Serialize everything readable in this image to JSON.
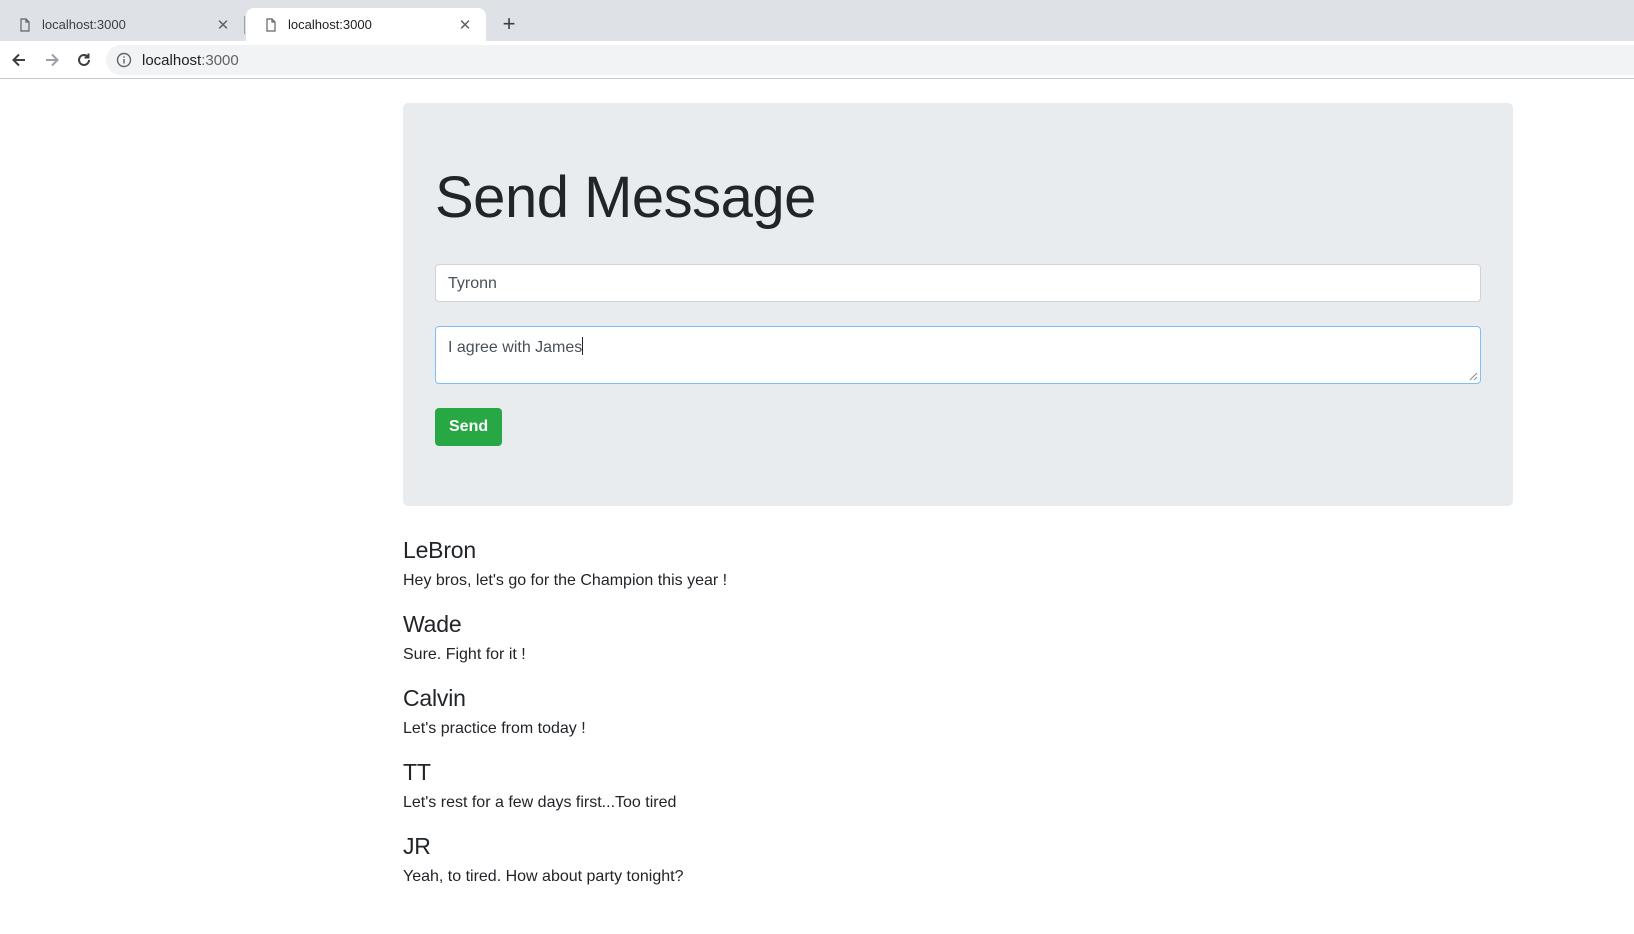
{
  "browser": {
    "tabs": [
      {
        "title": "localhost:3000",
        "active": false
      },
      {
        "title": "localhost:3000",
        "active": true
      }
    ],
    "address": {
      "host": "localhost",
      "port": ":3000"
    }
  },
  "form": {
    "title": "Send Message",
    "name_value": "Tyronn",
    "message_value": "I agree with James",
    "send_label": "Send"
  },
  "messages": [
    {
      "name": "LeBron",
      "text": "Hey bros, let's go for the Champion this year !"
    },
    {
      "name": "Wade",
      "text": "Sure. Fight for it !"
    },
    {
      "name": "Calvin",
      "text": "Let's practice from today !"
    },
    {
      "name": "TT",
      "text": "Let's rest for a few days first...Too tired"
    },
    {
      "name": "JR",
      "text": "Yeah, to tired. How about party tonight?"
    }
  ],
  "colors": {
    "accent_green": "#28a745",
    "jumbotron_bg": "#e9ecef",
    "focus_border": "#80bdff"
  },
  "icons": {
    "tab": "page-icon",
    "close": "close-icon",
    "new_tab": "plus-icon",
    "back": "back-arrow-icon",
    "forward": "forward-arrow-icon",
    "reload": "reload-icon",
    "site_info": "info-icon"
  }
}
